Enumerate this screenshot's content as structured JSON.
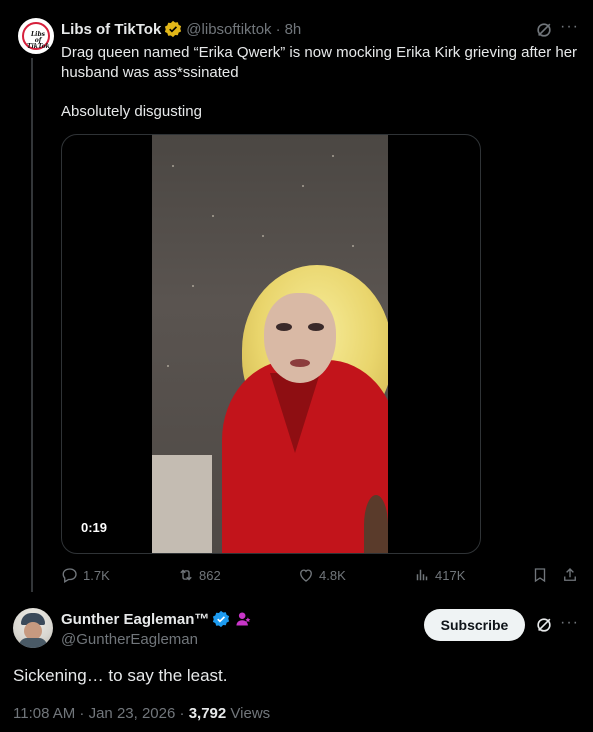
{
  "parent_tweet": {
    "name": "Libs of TikTok",
    "handle": "@libsoftiktok",
    "time": "8h",
    "avatar_text": "Libs of TikTok",
    "text": "Drag queen named “Erika Qwerk” is now mocking Erika Kirk grieving after her husband was ass*ssinated",
    "text2": "Absolutely disgusting",
    "video_duration": "0:19",
    "replies": "1.7K",
    "reposts": "862",
    "likes": "4.8K",
    "views": "417K"
  },
  "main_tweet": {
    "name": "Gunther Eagleman™",
    "handle": "@GuntherEagleman",
    "subscribe_label": "Subscribe",
    "text": "Sickening…  to say the least.",
    "timestamp": "11:08 AM · Jan 23, 2026",
    "views_count": "3,792",
    "views_label": "Views"
  },
  "colors": {
    "background": "#000000",
    "text_primary": "#e7e9ea",
    "text_secondary": "#71767b",
    "verified_blue": "#1d9bf0",
    "verified_gold": "#e2b719",
    "affiliate_pink": "#c936c9"
  },
  "icons": [
    "grok-icon",
    "more-icon",
    "reply-icon",
    "repost-icon",
    "like-icon",
    "views-icon",
    "bookmark-icon",
    "share-icon",
    "verified-gold-icon",
    "verified-blue-icon",
    "affiliate-icon"
  ]
}
